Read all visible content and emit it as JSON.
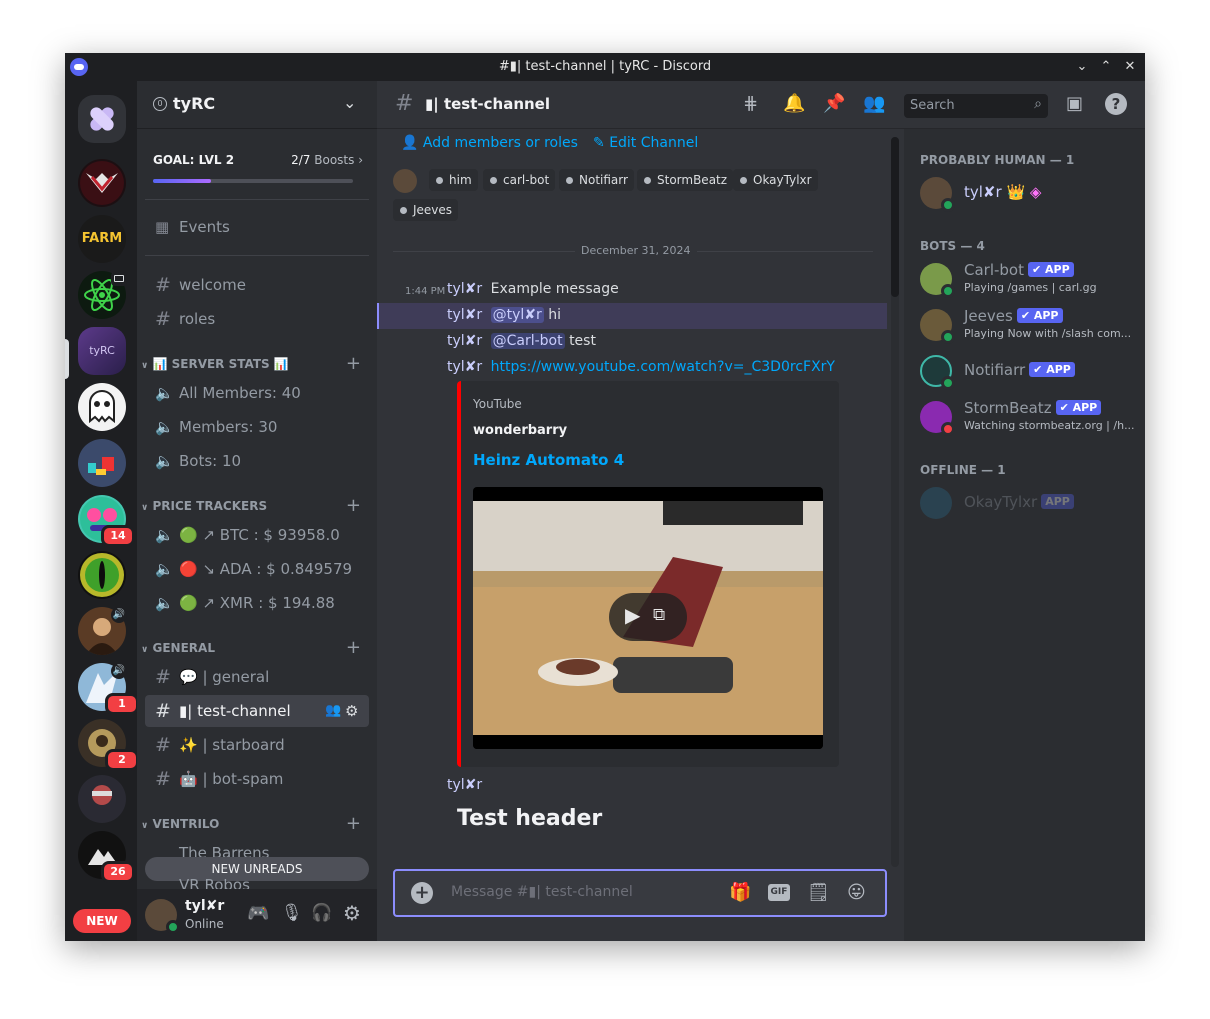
{
  "window": {
    "title": "#▮| test-channel | tyRC - Discord"
  },
  "guild": {
    "name": "tyRC",
    "boost_goal": "GOAL: LVL 2",
    "boosts": "2/7",
    "boosts_label": "Boosts",
    "boost_progress": 0.29
  },
  "sidebar": {
    "events": "Events",
    "top_channels": [
      "welcome",
      "roles"
    ],
    "server_stats": {
      "title": "📊 SERVER STATS 📊",
      "items": [
        "All Members: 40",
        "Members: 30",
        "Bots: 10"
      ]
    },
    "price_trackers": {
      "title": "PRICE TRACKERS",
      "items": [
        "🟢 ↗ BTC : $ 93958.0",
        "🔴 ↘ ADA : $ 0.849579",
        "🟢 ↗ XMR : $ 194.88"
      ]
    },
    "general": {
      "title": "GENERAL",
      "items": [
        "💬 | general",
        "▮| test-channel",
        "✨ | starboard",
        "🤖 | bot-spam"
      ]
    },
    "ventrilo": {
      "title": "VENTRILO",
      "items": [
        "The Barrens",
        "VR Robos"
      ]
    },
    "new_unreads": "NEW UNREADS"
  },
  "rail": {
    "badges": [
      "14",
      "1",
      "2",
      "26"
    ],
    "new_label": "NEW"
  },
  "user": {
    "name": "tyl✘r",
    "status": "Online"
  },
  "channel": {
    "name": "▮| test-channel",
    "search_placeholder": "Search"
  },
  "main": {
    "add_members": "Add members or roles",
    "edit_channel": "Edit Channel",
    "tags": [
      "him",
      "carl-bot",
      "Notifiarr",
      "StormBeatz",
      "OkayTylxr",
      "Jeeves"
    ],
    "date_divider": "December 31, 2024",
    "messages": [
      {
        "time": "1:44 PM",
        "author": "tyl✘r",
        "text": "Example message"
      },
      {
        "author": "tyl✘r",
        "mention": "@tyl✘r",
        "text": "hi"
      },
      {
        "author": "tyl✘r",
        "mention": "@Carl-bot",
        "text": "test"
      },
      {
        "author": "tyl✘r",
        "link": "https://www.youtube.com/watch?v=_C3D0rcFXrY"
      }
    ],
    "embed": {
      "provider": "YouTube",
      "author": "wonderbarry",
      "title": "Heinz Automato 4"
    },
    "last_author": "tyl✘r",
    "header_text": "Test header",
    "composer_placeholder": "Message #▮| test-channel"
  },
  "members": {
    "groups": [
      {
        "title": "PROBABLY HUMAN — 1",
        "items": [
          {
            "name": "tyl✘r",
            "suffix": "👑"
          }
        ]
      },
      {
        "title": "BOTS — 4",
        "items": [
          {
            "name": "Carl-bot",
            "status": "Playing /games | carl.gg"
          },
          {
            "name": "Jeeves",
            "status": "Playing Now with /slash com..."
          },
          {
            "name": "Notifiarr",
            "status": ""
          },
          {
            "name": "StormBeatz",
            "status": "Watching stormbeatz.org | /h..."
          }
        ]
      },
      {
        "title": "OFFLINE — 1",
        "items": [
          {
            "name": "OkayTylxr"
          }
        ]
      }
    ],
    "app_label": "APP"
  },
  "colors": {
    "accent": "#5865f2",
    "online": "#23a55a",
    "dnd": "#f23f43",
    "embed_bar": "#ff0000"
  }
}
